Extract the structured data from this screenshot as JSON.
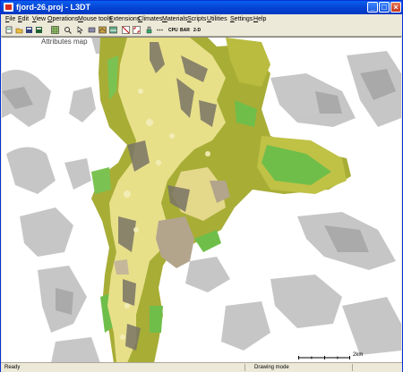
{
  "window": {
    "title": "fjord-26.proj - L3DT"
  },
  "menus": [
    "File",
    "Edit",
    "View",
    "Operations",
    "Mouse tools",
    "Extensions",
    "Climates",
    "Materials",
    "Scripts",
    "Utilities",
    "Settings",
    "Help"
  ],
  "toolbar": {
    "icons": [
      "new-icon",
      "open-icon",
      "save-icon",
      "save-all-icon",
      "grid-icon",
      "zoom-icon",
      "pointer-icon",
      "shape-icon",
      "map-icon",
      "layers-icon",
      "grid-select-icon",
      "fit-icon",
      "paint-icon",
      "dots-icon"
    ],
    "cpu_label": "CPU",
    "bar_label": "BAR",
    "mode_label": "2-D"
  },
  "viewport": {
    "map_name": "Attributes map",
    "scale_label": "2km"
  },
  "status": {
    "left": "Ready",
    "middle": "Drawing mode"
  }
}
